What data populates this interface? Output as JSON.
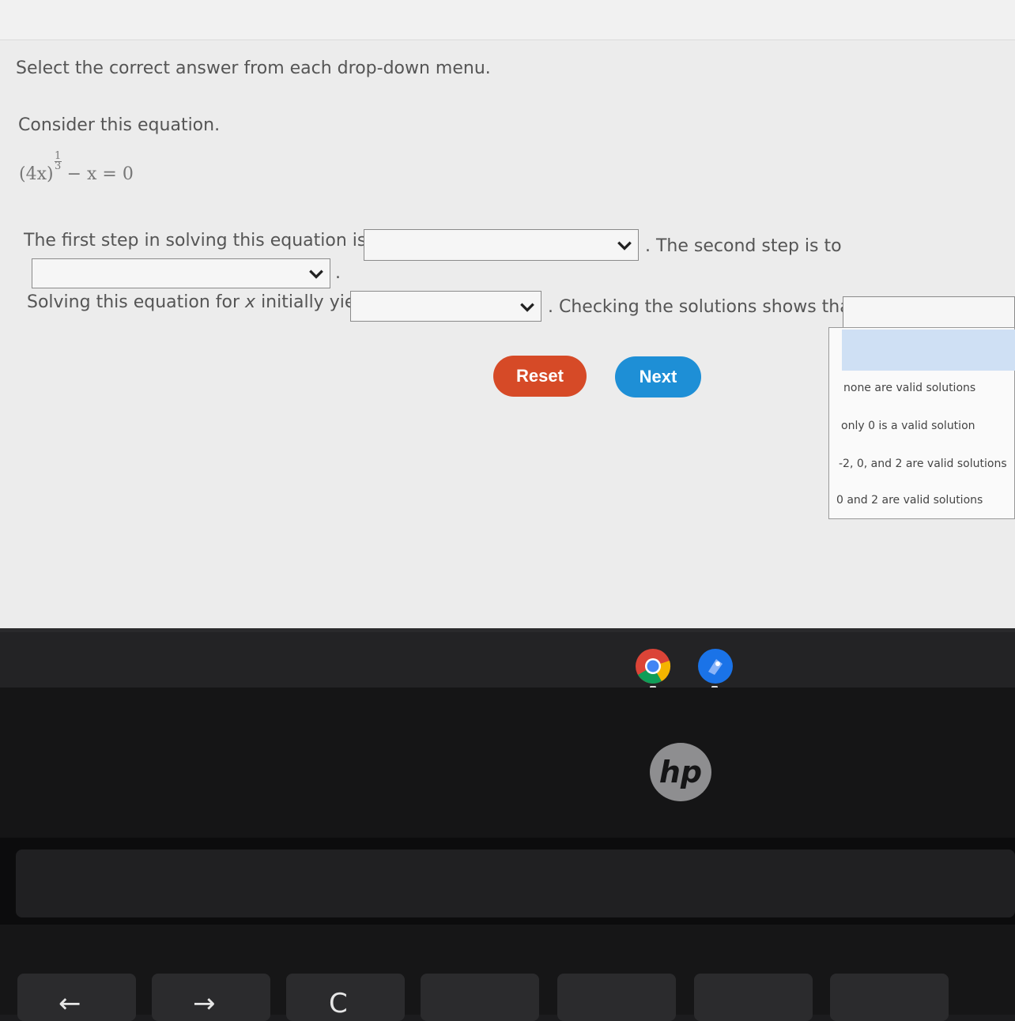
{
  "instructions": "Select the correct answer from each drop-down menu.",
  "prompt": "Consider this equation.",
  "equation": {
    "base": "(4x)",
    "exponent_numerator": "1",
    "exponent_denominator": "3",
    "rest": "− x = 0"
  },
  "sentence1": {
    "part1": "The first step in solving this equation is to",
    "part2": ". The second step is to",
    "part3": "."
  },
  "sentence2": {
    "part1": "Solving this equation for",
    "var": "x",
    "part1b": "initially yields",
    "part2": ". Checking the solutions shows that"
  },
  "buttons": {
    "reset": "Reset",
    "next": "Next"
  },
  "dropdown_options": [
    "none are valid solutions",
    "only 0 is a valid solution",
    "-2, 0, and 2 are valid solutions",
    "0 and 2 are valid solutions"
  ],
  "logo_text": "hp",
  "keys": {
    "back": "←",
    "forward": "→",
    "refresh": "C"
  },
  "colors": {
    "reset": "#d64a27",
    "next": "#1e8fd6",
    "highlight": "#cfe0f4"
  }
}
